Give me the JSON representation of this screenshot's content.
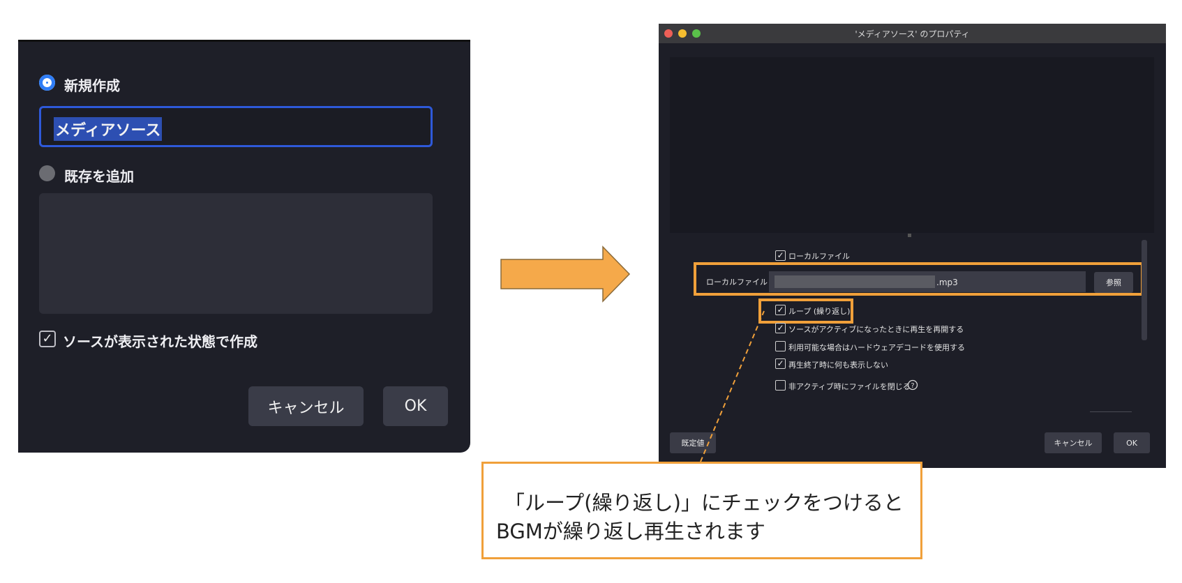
{
  "left_dialog": {
    "new_option_label": "新規作成",
    "name_value": "メディアソース",
    "existing_option_label": "既存を追加",
    "visible_checkbox_label": "ソースが表示された状態で作成",
    "cancel_label": "キャンセル",
    "ok_label": "OK"
  },
  "right_window": {
    "title": "'メディアソース' のプロパティ",
    "local_file_checkbox_label": "ローカルファイル",
    "local_file_field_label": "ローカルファイル",
    "local_file_value": ".mp3",
    "browse_label": "参照",
    "options": [
      {
        "label": "ループ (繰り返し)",
        "checked": true
      },
      {
        "label": "ソースがアクティブになったときに再生を再開する",
        "checked": true
      },
      {
        "label": "利用可能な場合はハードウェアデコードを使用する",
        "checked": false
      },
      {
        "label": "再生終了時に何も表示しない",
        "checked": true
      },
      {
        "label": "非アクティブ時にファイルを閉じる",
        "checked": false
      }
    ],
    "defaults_label": "既定値",
    "cancel_label": "キャンセル",
    "ok_label": "OK"
  },
  "callout": {
    "line1": "「ループ(繰り返し)」にチェックをつけると",
    "line2": "BGMが繰り返し再生されます"
  },
  "colors": {
    "highlight": "#f0a03a",
    "accent_blue": "#2f7df6",
    "dialog_bg": "#1e1f28"
  }
}
